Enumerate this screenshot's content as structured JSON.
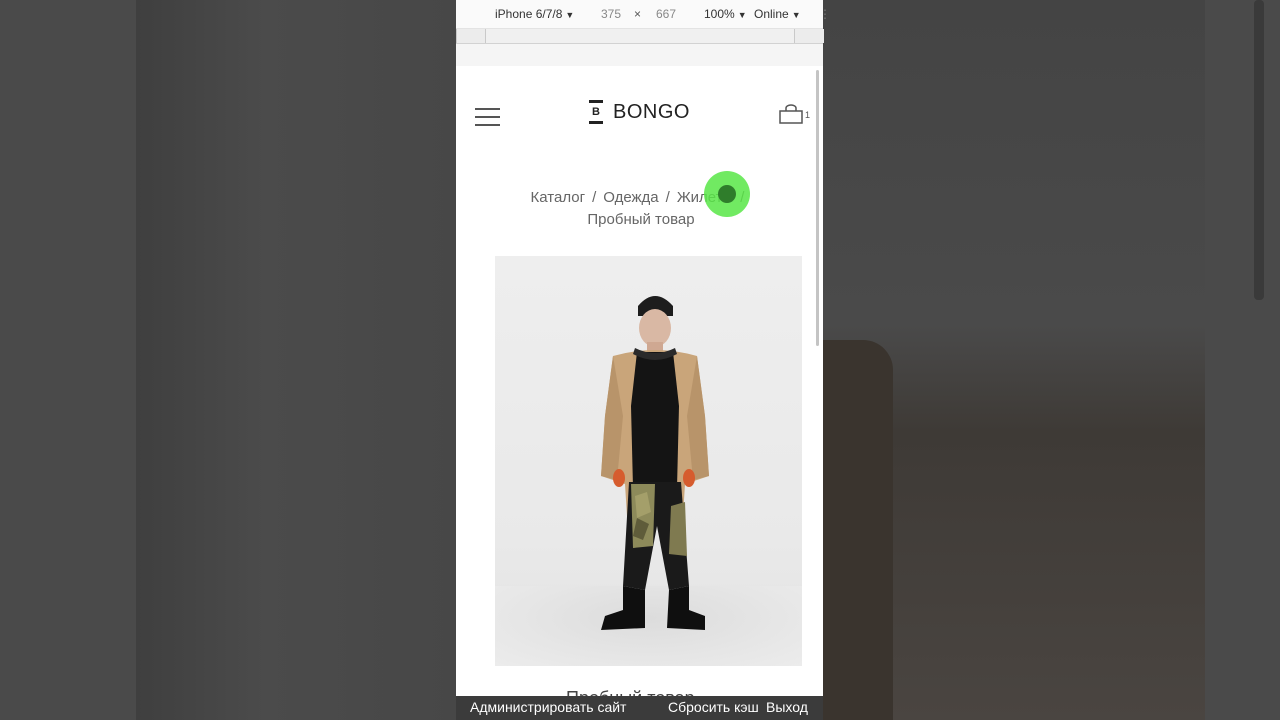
{
  "device_toolbar": {
    "device": "iPhone 6/7/8",
    "width": "375",
    "times": "×",
    "height": "667",
    "zoom": "100%",
    "network": "Online",
    "overflow": "⋮"
  },
  "header": {
    "logo_letter": "B",
    "logo_text": "BONGO",
    "cart_count": "1"
  },
  "breadcrumbs": {
    "items": [
      "Каталог",
      "Одежда",
      "Жилеты"
    ],
    "separator": "/",
    "current": "Пробный товар"
  },
  "product": {
    "title_partial": "Пробный товар"
  },
  "admin_bar": {
    "admin_label": "Администрировать сайт",
    "reset_cache_label": "Сбросить кэш",
    "logout_label": "Выход"
  },
  "colors": {
    "accent_click": "#58e646",
    "admin_bar_bg": "#3b3b3b",
    "jacket": "#c9a57a",
    "text_dark": "#222222"
  },
  "icons": [
    "hamburger-menu-icon",
    "bongo-logo-icon",
    "shopping-bag-icon"
  ]
}
